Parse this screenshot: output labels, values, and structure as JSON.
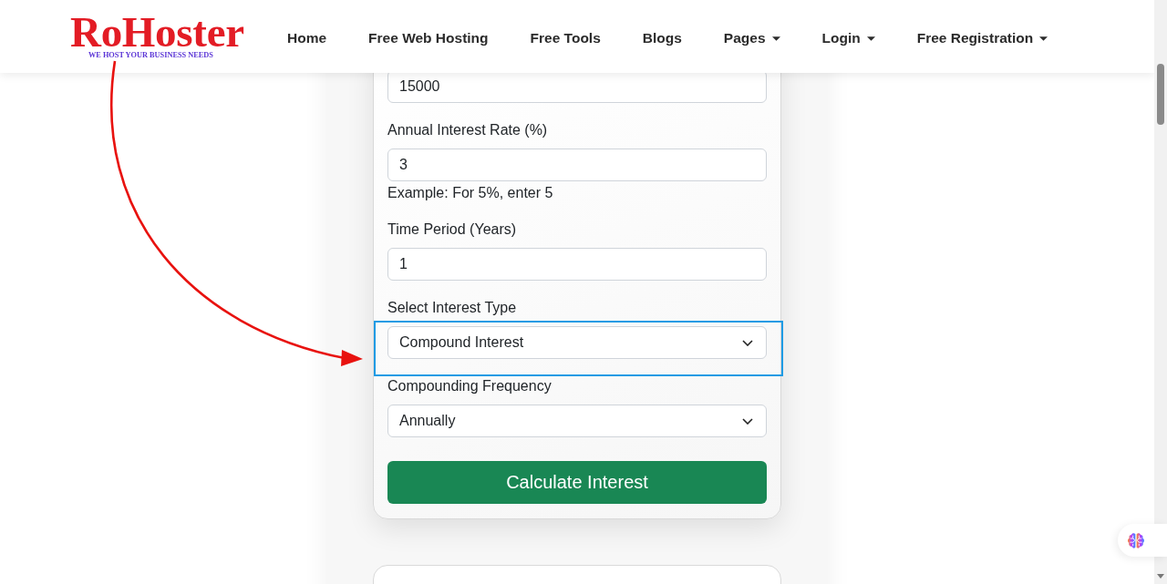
{
  "header": {
    "logo": {
      "name": "RoHoster",
      "tagline": "WE HOST YOUR BUSINESS NEEDS"
    },
    "nav": [
      {
        "label": "Home",
        "dropdown": false
      },
      {
        "label": "Free Web Hosting",
        "dropdown": false
      },
      {
        "label": "Free Tools",
        "dropdown": false
      },
      {
        "label": "Blogs",
        "dropdown": false
      },
      {
        "label": "Pages",
        "dropdown": true
      },
      {
        "label": "Login",
        "dropdown": true
      },
      {
        "label": "Free Registration",
        "dropdown": true
      }
    ]
  },
  "calculator": {
    "fields": [
      {
        "kind": "input",
        "value": "15000",
        "highlighted": false
      },
      {
        "kind": "input",
        "label": "Annual Interest Rate (%)",
        "value": "3",
        "help": "Example: For 5%, enter 5",
        "highlighted": false
      },
      {
        "kind": "input",
        "label": "Time Period (Years)",
        "value": "1",
        "highlighted": false
      },
      {
        "kind": "select",
        "label": "Select Interest Type",
        "value": "Compound Interest",
        "highlighted": true
      },
      {
        "kind": "select",
        "label": "Compounding Frequency",
        "value": "Annually",
        "highlighted": false
      }
    ],
    "button": "Calculate Interest"
  }
}
